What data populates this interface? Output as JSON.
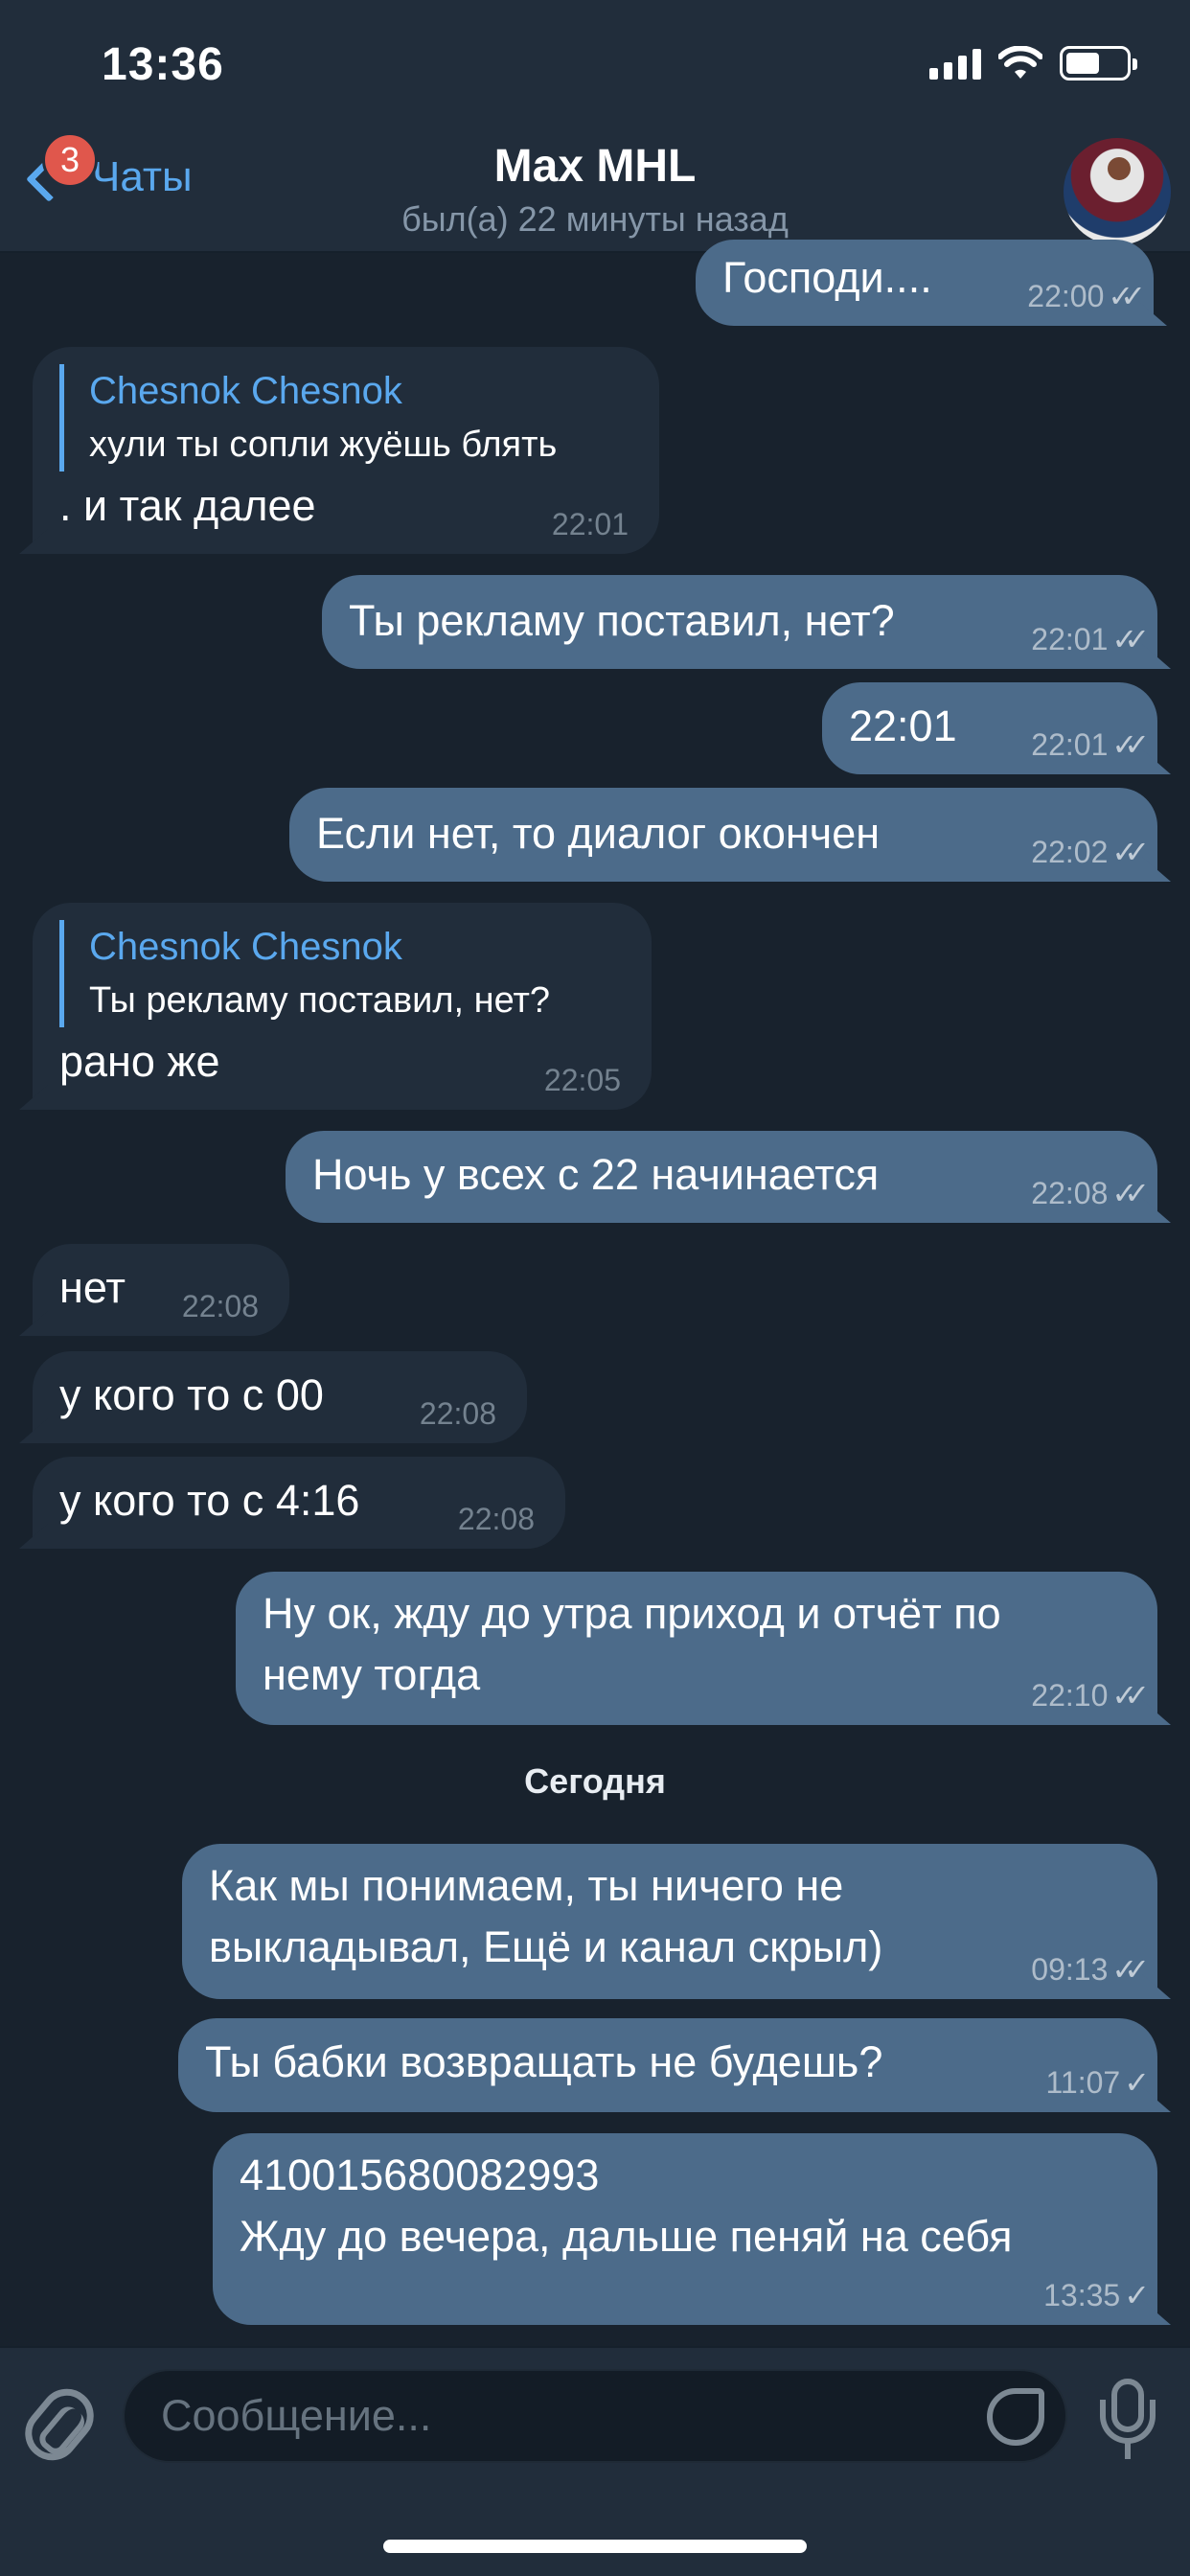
{
  "status_bar": {
    "time": "13:36"
  },
  "header": {
    "back_label": "Чаты",
    "unread_badge": "3",
    "title": "Max MHL",
    "subtitle": "был(а) 22 минуты назад"
  },
  "messages": [
    {
      "dir": "out",
      "text": "Господи....",
      "time": "22:00",
      "status": "read"
    },
    {
      "dir": "in",
      "reply_name": "Chesnok Chesnok",
      "reply_text": "хули ты сопли жуёшь блять",
      "text": ". и так далее",
      "time": "22:01"
    },
    {
      "dir": "out",
      "text": "Ты рекламу поставил, нет?",
      "time": "22:01",
      "status": "read"
    },
    {
      "dir": "out",
      "text": "22:01",
      "time": "22:01",
      "status": "read"
    },
    {
      "dir": "out",
      "text": "Если нет, то диалог окончен",
      "time": "22:02",
      "status": "read"
    },
    {
      "dir": "in",
      "reply_name": "Chesnok Chesnok",
      "reply_text": "Ты рекламу поставил, нет?",
      "text": "рано же",
      "time": "22:05"
    },
    {
      "dir": "out",
      "text": "Ночь у всех с 22 начинается",
      "time": "22:08",
      "status": "read"
    },
    {
      "dir": "in",
      "text": "нет",
      "time": "22:08"
    },
    {
      "dir": "in",
      "text": "у кого то с 00",
      "time": "22:08"
    },
    {
      "dir": "in",
      "text": "у кого то с 4:16",
      "time": "22:08"
    },
    {
      "dir": "out",
      "text": "Ну ок, жду до утра приход и отчёт по\nнему тогда",
      "time": "22:10",
      "status": "read"
    },
    {
      "dir": "out",
      "text": "Как мы понимаем, ты ничего не\nвыкладывал, Ещё и канал скрыл)",
      "time": "09:13",
      "status": "read"
    },
    {
      "dir": "out",
      "text": "Ты бабки возвращать не будешь?",
      "time": "11:07",
      "status": "sent"
    },
    {
      "dir": "out",
      "text": "410015680082993\nЖду до вечера, дальше пеняй на себя",
      "time": "13:35",
      "status": "sent"
    }
  ],
  "date_separator": "Сегодня",
  "composer": {
    "placeholder": "Сообщение..."
  }
}
